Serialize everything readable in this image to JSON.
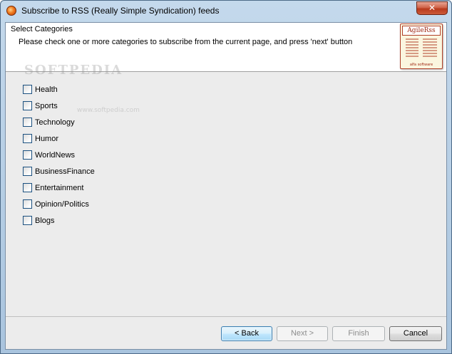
{
  "window": {
    "title": "Subscribe to RSS (Really Simple Syndication) feeds",
    "close_glyph": "✕"
  },
  "header": {
    "title": "Select Categories",
    "description": "Please check one or more categories to subscribe from the current page, and press 'next' button"
  },
  "logo": {
    "title": "AgileRss",
    "footer": "alfa software"
  },
  "watermark": {
    "text": "SOFTPEDIA",
    "url": "www.softpedia.com"
  },
  "categories": [
    {
      "label": "Health",
      "checked": false
    },
    {
      "label": "Sports",
      "checked": false
    },
    {
      "label": "Technology",
      "checked": false
    },
    {
      "label": "Humor",
      "checked": false
    },
    {
      "label": "WorldNews",
      "checked": false
    },
    {
      "label": "BusinessFinance",
      "checked": false
    },
    {
      "label": "Entertainment",
      "checked": false
    },
    {
      "label": "Opinion/Politics",
      "checked": false
    },
    {
      "label": "Blogs",
      "checked": false
    }
  ],
  "buttons": {
    "back": "< Back",
    "next": "Next >",
    "finish": "Finish",
    "cancel": "Cancel"
  }
}
